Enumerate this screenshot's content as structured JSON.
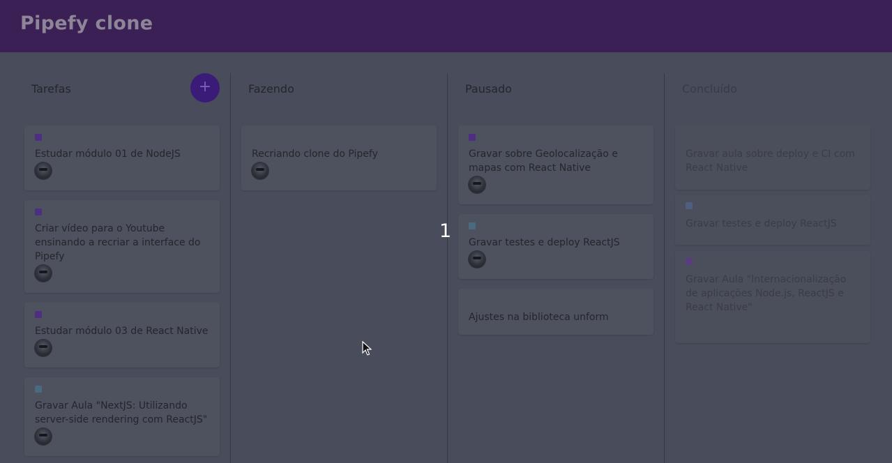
{
  "app": {
    "title": "Pipefy clone"
  },
  "lists": [
    {
      "title": "Tarefas",
      "has_add": true,
      "add_label": "+",
      "cards": [
        {
          "label_color": "#4e2e80",
          "text": "Estudar módulo 01 de NodeJS",
          "avatar": true
        },
        {
          "label_color": "#4e2e80",
          "text": "Criar vídeo para o Youtube ensinando a recriar a interface do Pipefy",
          "avatar": true
        },
        {
          "label_color": "#4e2e80",
          "text": "Estudar módulo 03 de React Native",
          "avatar": true
        },
        {
          "label_color": "#4a6a82",
          "text": "Gravar Aula \"NextJS: Utilizando server-side rendering com ReactJS\"",
          "avatar": true
        }
      ]
    },
    {
      "title": "Fazendo",
      "cards": [
        {
          "label_color": null,
          "text": "Recriando clone do Pipefy",
          "avatar": true
        }
      ]
    },
    {
      "title": "Pausado",
      "cards": [
        {
          "label_color": "#4e2e80",
          "text": "Gravar sobre Geolocalização e mapas com React Native",
          "avatar": true
        },
        {
          "label_color": "#4a6a82",
          "text": "Gravar testes e deploy ReactJS",
          "avatar": true
        },
        {
          "label_color": null,
          "text": "Ajustes na biblioteca unform",
          "avatar": false
        }
      ]
    },
    {
      "title": "Concluído",
      "done": true,
      "cards": [
        {
          "label_color": null,
          "text": "Gravar aula sobre deploy e CI com React Native",
          "avatar": false
        },
        {
          "label_color": "#4d6082",
          "text": "Gravar testes e deploy ReactJS",
          "avatar": false
        },
        {
          "label_color": "#593d80",
          "text": "Gravar Aula \"Internacionalização de aplicações Node.js, ReactJS e React Native\"",
          "avatar": false
        }
      ]
    }
  ],
  "overlay": {
    "number": "1"
  }
}
